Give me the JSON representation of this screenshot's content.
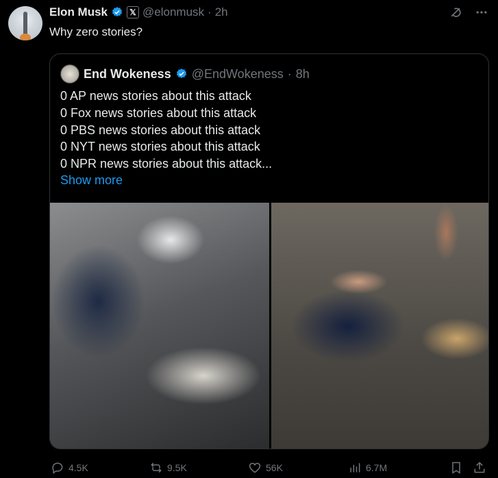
{
  "tweet": {
    "author_name": "Elon Musk",
    "handle": "@elonmusk",
    "separator": "·",
    "time": "2h",
    "affiliate_badge": "𝕏",
    "text": "Why zero stories?"
  },
  "quote": {
    "author_name": "End Wokeness",
    "handle": "@EndWokeness",
    "separator": "·",
    "time": "8h",
    "lines": [
      "0 AP news stories about this attack",
      "0 Fox news stories about this attack",
      "0 PBS news stories about this attack",
      "0 NYT news stories about this attack",
      "0 NPR news stories about this attack..."
    ],
    "show_more": "Show more"
  },
  "actions": {
    "replies": "4.5K",
    "reposts": "9.5K",
    "likes": "56K",
    "views": "6.7M"
  },
  "colors": {
    "background": "#000000",
    "text": "#e7e9ea",
    "muted": "#71767b",
    "accent": "#1d9bf0",
    "border": "#2f3336"
  },
  "icons": [
    "verified-badge-icon",
    "x-affiliate-icon",
    "grok-icon",
    "more-icon",
    "reply-icon",
    "repost-icon",
    "like-icon",
    "views-icon",
    "bookmark-icon",
    "share-icon"
  ]
}
